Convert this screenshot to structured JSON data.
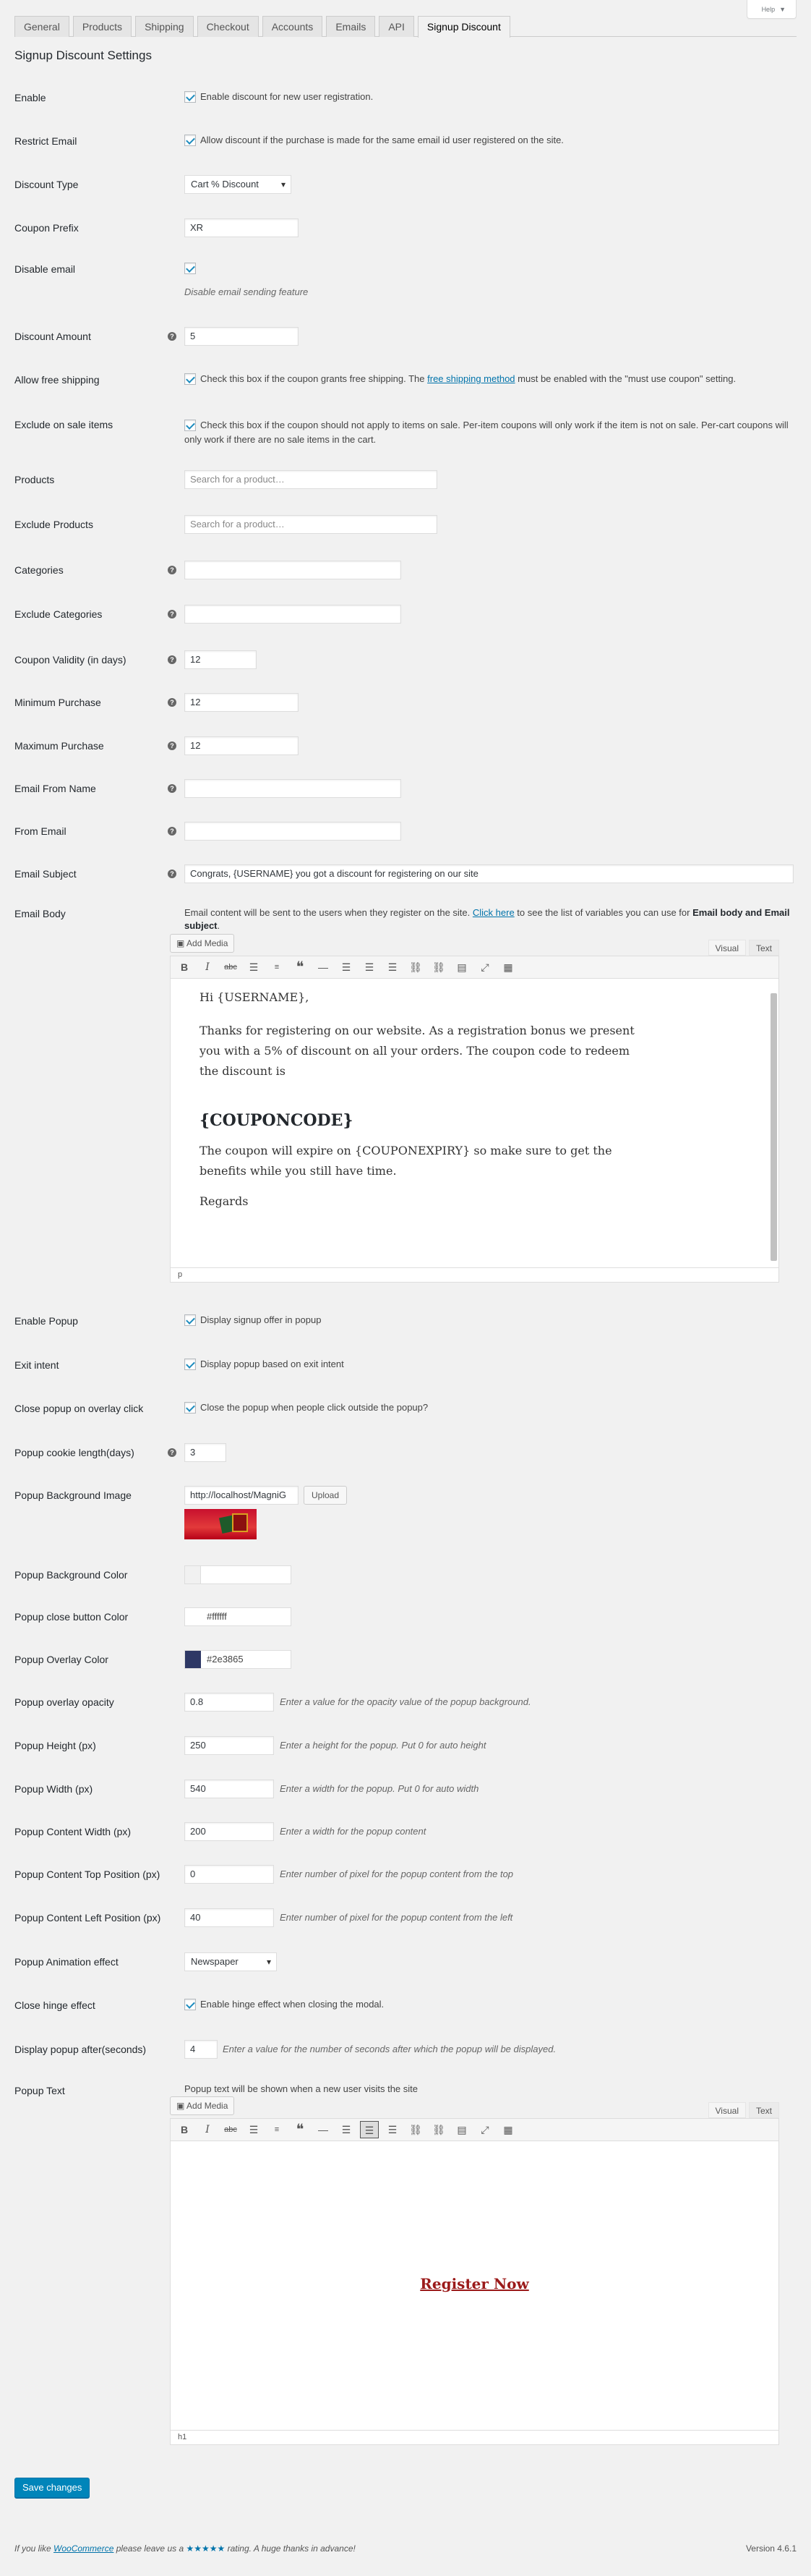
{
  "help": {
    "label": "Help",
    "arrow": "▼"
  },
  "tabs": [
    "General",
    "Products",
    "Shipping",
    "Checkout",
    "Accounts",
    "Emails",
    "API",
    "Signup Discount"
  ],
  "heading": "Signup Discount Settings",
  "enable": {
    "label": "Enable",
    "text": "Enable discount for new user registration."
  },
  "restrict": {
    "label": "Restrict Email",
    "text": "Allow discount if the purchase is made for the same email id user registered on the site."
  },
  "discount_type": {
    "label": "Discount Type",
    "value": "Cart % Discount"
  },
  "coupon_prefix": {
    "label": "Coupon Prefix",
    "value": "XR"
  },
  "disable_email": {
    "label": "Disable email",
    "desc": "Disable email sending feature"
  },
  "discount_amount": {
    "label": "Discount Amount",
    "value": "5"
  },
  "free_shipping": {
    "label": "Allow free shipping",
    "text1": "Check this box if the coupon grants free shipping. The ",
    "link": "free shipping method",
    "text2": " must be enabled with the \"must use coupon\" setting."
  },
  "exclude_sale": {
    "label": "Exclude on sale items",
    "text": "Check this box if the coupon should not apply to items on sale. Per-item coupons will only work if the item is not on sale. Per-cart coupons will only work if there are no sale items in the cart."
  },
  "products": {
    "label": "Products",
    "placeholder": "Search for a product…"
  },
  "exclude_products": {
    "label": "Exclude Products",
    "placeholder": "Search for a product…"
  },
  "categories": {
    "label": "Categories"
  },
  "exclude_categories": {
    "label": "Exclude Categories"
  },
  "validity": {
    "label": "Coupon Validity (in days)",
    "value": "12"
  },
  "min_purchase": {
    "label": "Minimum Purchase",
    "value": "12"
  },
  "max_purchase": {
    "label": "Maximum Purchase",
    "value": "12"
  },
  "email_from_name": {
    "label": "Email From Name"
  },
  "from_email": {
    "label": "From Email"
  },
  "email_subject": {
    "label": "Email Subject",
    "value": "Congrats, {USERNAME} you got a discount for registering on our site"
  },
  "email_body": {
    "label": "Email Body",
    "desc1": "Email content will be sent to the users when they register on the site. ",
    "link": "Click here",
    "desc2": " to see the list of variables you can use for ",
    "bold": "Email body and Email subject",
    "desc3": ".",
    "line1": "Hi {USERNAME},",
    "para": "Thanks for registering on our website. As a registration bonus we present you with a 5% of discount on all your orders. The coupon code to redeem the discount is",
    "code": "{COUPONCODE}",
    "para2": "The coupon will expire on {COUPONEXPIRY} so make sure to get the benefits while you still have time.",
    "regards": "Regards",
    "path": "p"
  },
  "editor": {
    "add_media": "Add Media",
    "visual": "Visual",
    "text": "Text"
  },
  "enable_popup": {
    "label": "Enable Popup",
    "text": "Display signup offer in popup"
  },
  "exit_intent": {
    "label": "Exit intent",
    "text": "Display popup based on exit intent"
  },
  "close_overlay": {
    "label": "Close popup on overlay click",
    "text": "Close the popup when people click outside the popup?"
  },
  "cookie": {
    "label": "Popup cookie length(days)",
    "value": "3"
  },
  "bg_image": {
    "label": "Popup Background Image",
    "value": "http://localhost/MagniG",
    "button": "Upload"
  },
  "bg_color": {
    "label": "Popup Background Color",
    "value": "",
    "color": "#f1f1f1"
  },
  "close_color": {
    "label": "Popup close button Color",
    "value": "#ffffff",
    "color": "#ffffff"
  },
  "overlay_color": {
    "label": "Popup Overlay Color",
    "value": "#2e3865",
    "color": "#2e3865"
  },
  "opacity": {
    "label": "Popup overlay opacity",
    "value": "0.8",
    "desc": "Enter a value for the opacity value of the popup background."
  },
  "height": {
    "label": "Popup Height (px)",
    "value": "250",
    "desc": "Enter a height for the popup. Put 0 for auto height"
  },
  "width": {
    "label": "Popup Width (px)",
    "value": "540",
    "desc": "Enter a width for the popup. Put 0 for auto width"
  },
  "content_width": {
    "label": "Popup Content Width (px)",
    "value": "200",
    "desc": "Enter a width for the popup content"
  },
  "content_top": {
    "label": "Popup Content Top Position (px)",
    "value": "0",
    "desc": "Enter number of pixel for the popup content from the top"
  },
  "content_left": {
    "label": "Popup Content Left Position (px)",
    "value": "40",
    "desc": "Enter number of pixel for the popup content from the left"
  },
  "animation": {
    "label": "Popup Animation effect",
    "value": "Newspaper"
  },
  "hinge": {
    "label": "Close hinge effect",
    "text": "Enable hinge effect when closing the modal."
  },
  "display_after": {
    "label": "Display popup after(seconds)",
    "value": "4",
    "desc": "Enter a value for the number of seconds after which the popup will be displayed."
  },
  "popup_text": {
    "label": "Popup Text",
    "desc": "Popup text will be shown when a new user visits the site",
    "content": "Register Now",
    "path": "h1"
  },
  "save": "Save changes",
  "footer": {
    "t1": "If you like ",
    "brand": "WooCommerce",
    "t2": " please leave us a ",
    "stars": "★★★★★",
    "t3": " rating. A huge thanks in advance!",
    "version": "Version 4.6.1"
  }
}
